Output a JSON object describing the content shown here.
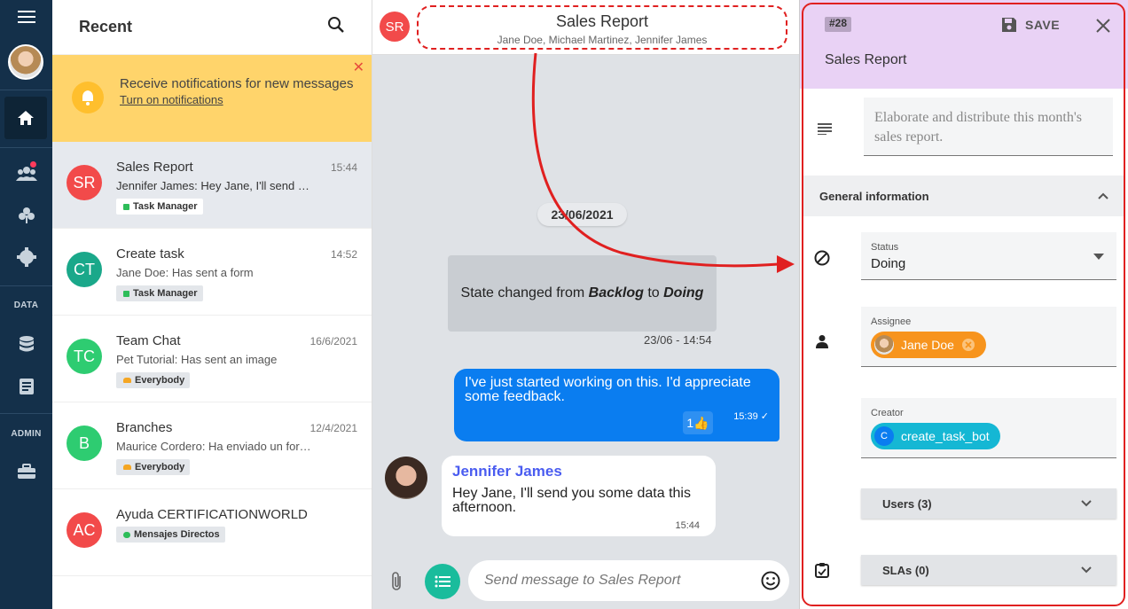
{
  "rail": {
    "menu_icon": "hamburger-menu-icon",
    "section_data": "DATA",
    "section_admin": "ADMIN"
  },
  "list": {
    "title": "Recent",
    "notification": {
      "text": "Receive notifications for new messages",
      "link": "Turn on notifications"
    },
    "chats": [
      {
        "initials": "SR",
        "name": "Sales Report",
        "time": "15:44",
        "preview": "Jennifer James: Hey Jane, I'll send you some data this afternoon.",
        "tag": "Task Manager",
        "color": "#f24a4a"
      },
      {
        "initials": "CT",
        "name": "Create task",
        "time": "14:52",
        "preview": "Jane Doe: Has sent a form",
        "tag": "Task Manager",
        "color": "#1aa88a"
      },
      {
        "initials": "TC",
        "name": "Team Chat",
        "time": "16/6/2021",
        "preview": "Pet Tutorial: Has sent an image",
        "tag": "Everybody",
        "color": "#2ecc71"
      },
      {
        "initials": "B",
        "name": "Branches",
        "time": "12/4/2021",
        "preview": "Maurice Cordero: Ha enviado un formulario",
        "tag": "Everybody",
        "color": "#2ecc71"
      },
      {
        "initials": "AC",
        "name": "Ayuda CERTIFICATIONWORLD",
        "time": "",
        "preview": "",
        "tag": "Mensajes Directos",
        "color": "#f24a4a"
      }
    ]
  },
  "chat": {
    "avatar": "SR",
    "title": "Sales Report",
    "members": "Jane Doe, Michael Martinez, Jennifer James",
    "date": "23/06/2021",
    "system": {
      "prefix": "State changed from ",
      "from": "Backlog",
      "mid": " to ",
      "to": "Doing",
      "time": "23/06 - 14:54"
    },
    "outgoing": {
      "text": "I've just started working on this. I'd appreciate some feedback.",
      "reaction_count": "1",
      "time": "15:39"
    },
    "incoming": {
      "sender": "Jennifer James",
      "text": "Hey Jane, I'll send you some data this afternoon.",
      "time": "15:44"
    },
    "composer_placeholder": "Send message to Sales Report"
  },
  "panel": {
    "number": "#28",
    "save": "SAVE",
    "title": "Sales Report",
    "description": "Elaborate and distribute this month's sales report.",
    "general_info": "General information",
    "status_label": "Status",
    "status_value": "Doing",
    "assignee_label": "Assignee",
    "assignee": "Jane Doe",
    "creator_label": "Creator",
    "creator": "create_task_bot",
    "creator_initial": "C",
    "users": "Users (3)",
    "slas": "SLAs (0)"
  },
  "colors": {
    "accent": "#0a7df0",
    "rail": "#14304a",
    "notice": "#ffd46b",
    "panel_header": "#e9d2f5",
    "annotation": "#e02020"
  }
}
